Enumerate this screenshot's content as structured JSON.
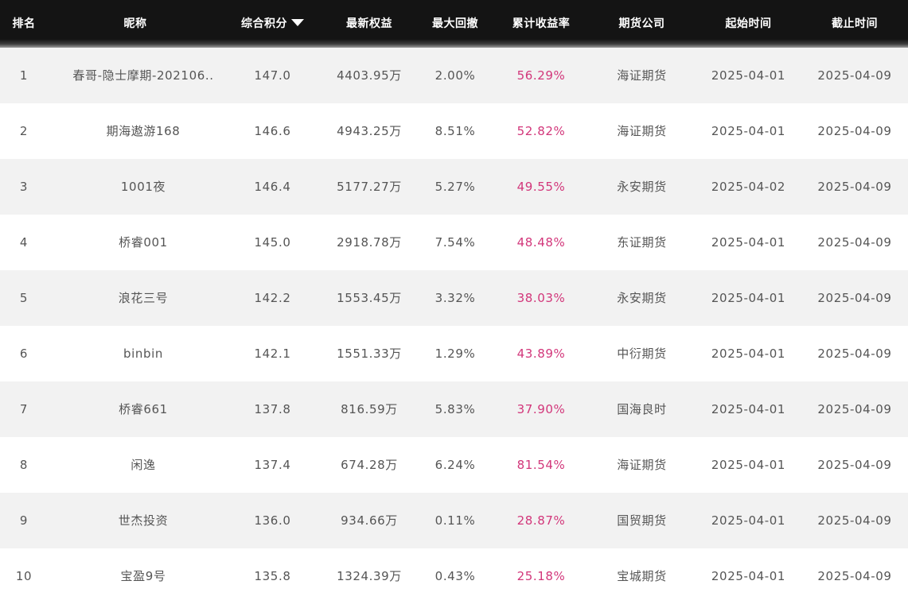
{
  "header": {
    "rank": "排名",
    "nickname": "昵称",
    "score": "综合积分",
    "equity": "最新权益",
    "drawdown": "最大回撤",
    "return": "累计收益率",
    "company": "期货公司",
    "start": "起始时间",
    "end": "截止时间",
    "sort_icon": "caret-down-icon"
  },
  "colors": {
    "header_bg": "#141414",
    "row_alt_bg": "#f2f2f2",
    "return_color": "#d2367a"
  },
  "rows": [
    {
      "rank": "1",
      "nickname": "春哥-隐士摩期-202106..",
      "score": "147.0",
      "equity": "4403.95万",
      "drawdown": "2.00%",
      "return": "56.29%",
      "company": "海证期货",
      "start": "2025-04-01",
      "end": "2025-04-09"
    },
    {
      "rank": "2",
      "nickname": "期海遨游168",
      "score": "146.6",
      "equity": "4943.25万",
      "drawdown": "8.51%",
      "return": "52.82%",
      "company": "海证期货",
      "start": "2025-04-01",
      "end": "2025-04-09"
    },
    {
      "rank": "3",
      "nickname": "1001夜",
      "score": "146.4",
      "equity": "5177.27万",
      "drawdown": "5.27%",
      "return": "49.55%",
      "company": "永安期货",
      "start": "2025-04-02",
      "end": "2025-04-09"
    },
    {
      "rank": "4",
      "nickname": "桥睿001",
      "score": "145.0",
      "equity": "2918.78万",
      "drawdown": "7.54%",
      "return": "48.48%",
      "company": "东证期货",
      "start": "2025-04-01",
      "end": "2025-04-09"
    },
    {
      "rank": "5",
      "nickname": "浪花三号",
      "score": "142.2",
      "equity": "1553.45万",
      "drawdown": "3.32%",
      "return": "38.03%",
      "company": "永安期货",
      "start": "2025-04-01",
      "end": "2025-04-09"
    },
    {
      "rank": "6",
      "nickname": "binbin",
      "score": "142.1",
      "equity": "1551.33万",
      "drawdown": "1.29%",
      "return": "43.89%",
      "company": "中衍期货",
      "start": "2025-04-01",
      "end": "2025-04-09"
    },
    {
      "rank": "7",
      "nickname": "桥睿661",
      "score": "137.8",
      "equity": "816.59万",
      "drawdown": "5.83%",
      "return": "37.90%",
      "company": "国海良时",
      "start": "2025-04-01",
      "end": "2025-04-09"
    },
    {
      "rank": "8",
      "nickname": "闲逸",
      "score": "137.4",
      "equity": "674.28万",
      "drawdown": "6.24%",
      "return": "81.54%",
      "company": "海证期货",
      "start": "2025-04-01",
      "end": "2025-04-09"
    },
    {
      "rank": "9",
      "nickname": "世杰投资",
      "score": "136.0",
      "equity": "934.66万",
      "drawdown": "0.11%",
      "return": "28.87%",
      "company": "国贸期货",
      "start": "2025-04-01",
      "end": "2025-04-09"
    },
    {
      "rank": "10",
      "nickname": "宝盈9号",
      "score": "135.8",
      "equity": "1324.39万",
      "drawdown": "0.43%",
      "return": "25.18%",
      "company": "宝城期货",
      "start": "2025-04-01",
      "end": "2025-04-09"
    }
  ]
}
